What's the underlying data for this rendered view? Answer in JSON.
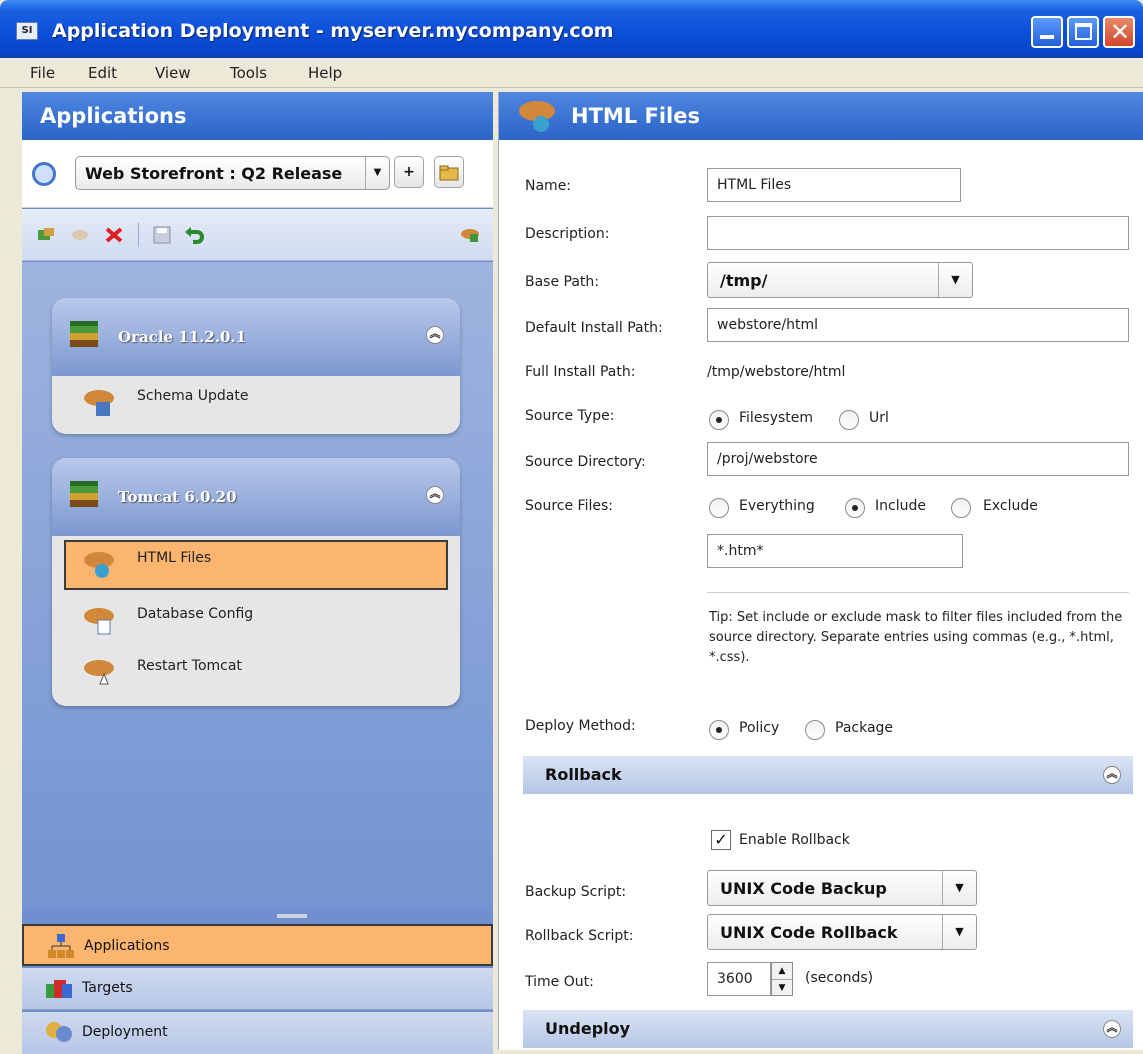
{
  "window": {
    "icon_label": "SI",
    "title": "Application Deployment - myserver.mycompany.com"
  },
  "menu": [
    "File",
    "Edit",
    "View",
    "Tools",
    "Help"
  ],
  "left_panel": {
    "header": "Applications",
    "selected_app": "Web Storefront : Q2 Release",
    "add_label": "+",
    "groups": [
      {
        "title": "Oracle 11.2.0.1",
        "items": [
          {
            "label": "Schema Update"
          }
        ]
      },
      {
        "title": "Tomcat 6.0.20",
        "items": [
          {
            "label": "HTML Files",
            "selected": true
          },
          {
            "label": "Database Config"
          },
          {
            "label": "Restart Tomcat"
          }
        ]
      }
    ],
    "nav": [
      "Applications",
      "Targets",
      "Deployment"
    ]
  },
  "detail": {
    "header": "HTML Files",
    "labels": {
      "name": "Name:",
      "description": "Description:",
      "base_path": "Base Path:",
      "default_install_path": "Default Install Path:",
      "full_install_path": "Full Install Path:",
      "source_type": "Source Type:",
      "source_directory": "Source Directory:",
      "source_files": "Source Files:",
      "deploy_method": "Deploy Method:",
      "backup_script": "Backup Script:",
      "rollback_script": "Rollback Script:",
      "time_out": "Time Out:"
    },
    "name": "HTML Files",
    "description": "",
    "base_path": "/tmp/",
    "default_install_path": "webstore/html",
    "full_install_path": "/tmp/webstore/html",
    "source_type": {
      "options": [
        "Filesystem",
        "Url"
      ],
      "selected": "Filesystem"
    },
    "source_directory": "/proj/webstore",
    "source_files": {
      "options": [
        "Everything",
        "Include",
        "Exclude"
      ],
      "selected": "Include"
    },
    "include_mask": "*.htm*",
    "tip": "Tip: Set include or exclude mask to filter files included from the source directory. Separate entries using commas (e.g., *.html, *.css).",
    "deploy_method": {
      "options": [
        "Policy",
        "Package"
      ],
      "selected": "Policy"
    },
    "rollback": {
      "section_title": "Rollback",
      "enable_label": "Enable Rollback",
      "enabled": true,
      "backup_script": "UNIX Code Backup",
      "rollback_script": "UNIX Code Rollback",
      "time_out": "3600",
      "time_out_unit": "(seconds)"
    },
    "undeploy": {
      "section_title": "Undeploy"
    }
  },
  "colors": {
    "title_blue": "#0a4ed8",
    "header_blue": "#2b64c8",
    "selection_orange": "#fbb56e",
    "left_panel_blue": "#7393d2"
  }
}
